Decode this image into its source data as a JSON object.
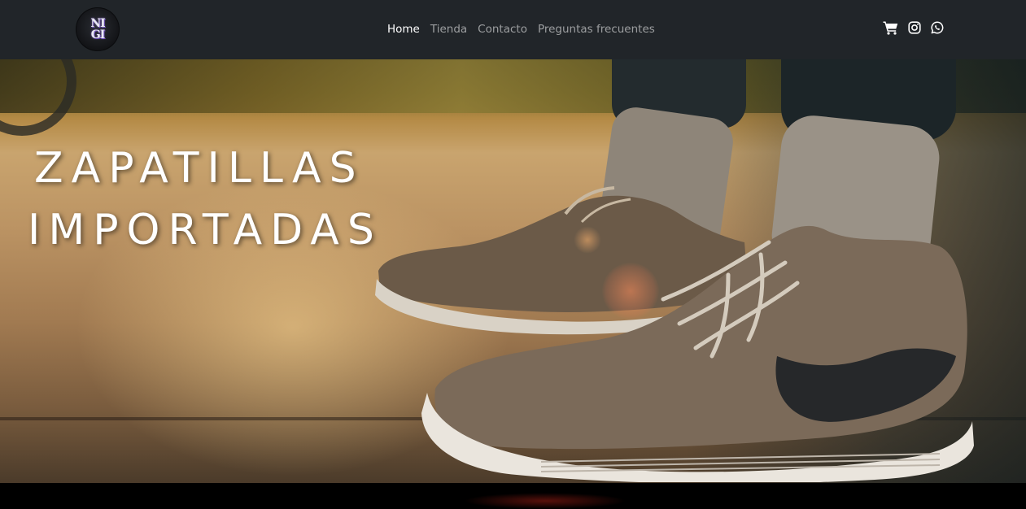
{
  "navbar": {
    "logo_text_line1": "NI",
    "logo_text_line2": "GI",
    "links": [
      {
        "label": "Home",
        "active": true
      },
      {
        "label": "Tienda",
        "active": false
      },
      {
        "label": "Contacto",
        "active": false
      },
      {
        "label": "Preguntas frecuentes",
        "active": false
      }
    ],
    "icons": [
      "cart-icon",
      "instagram-icon",
      "whatsapp-icon"
    ],
    "background": "#212529"
  },
  "hero": {
    "title_line1": "ZAPATILLAS",
    "title_line2": "IMPORTADAS",
    "image_subject": "sneakers-photo"
  }
}
